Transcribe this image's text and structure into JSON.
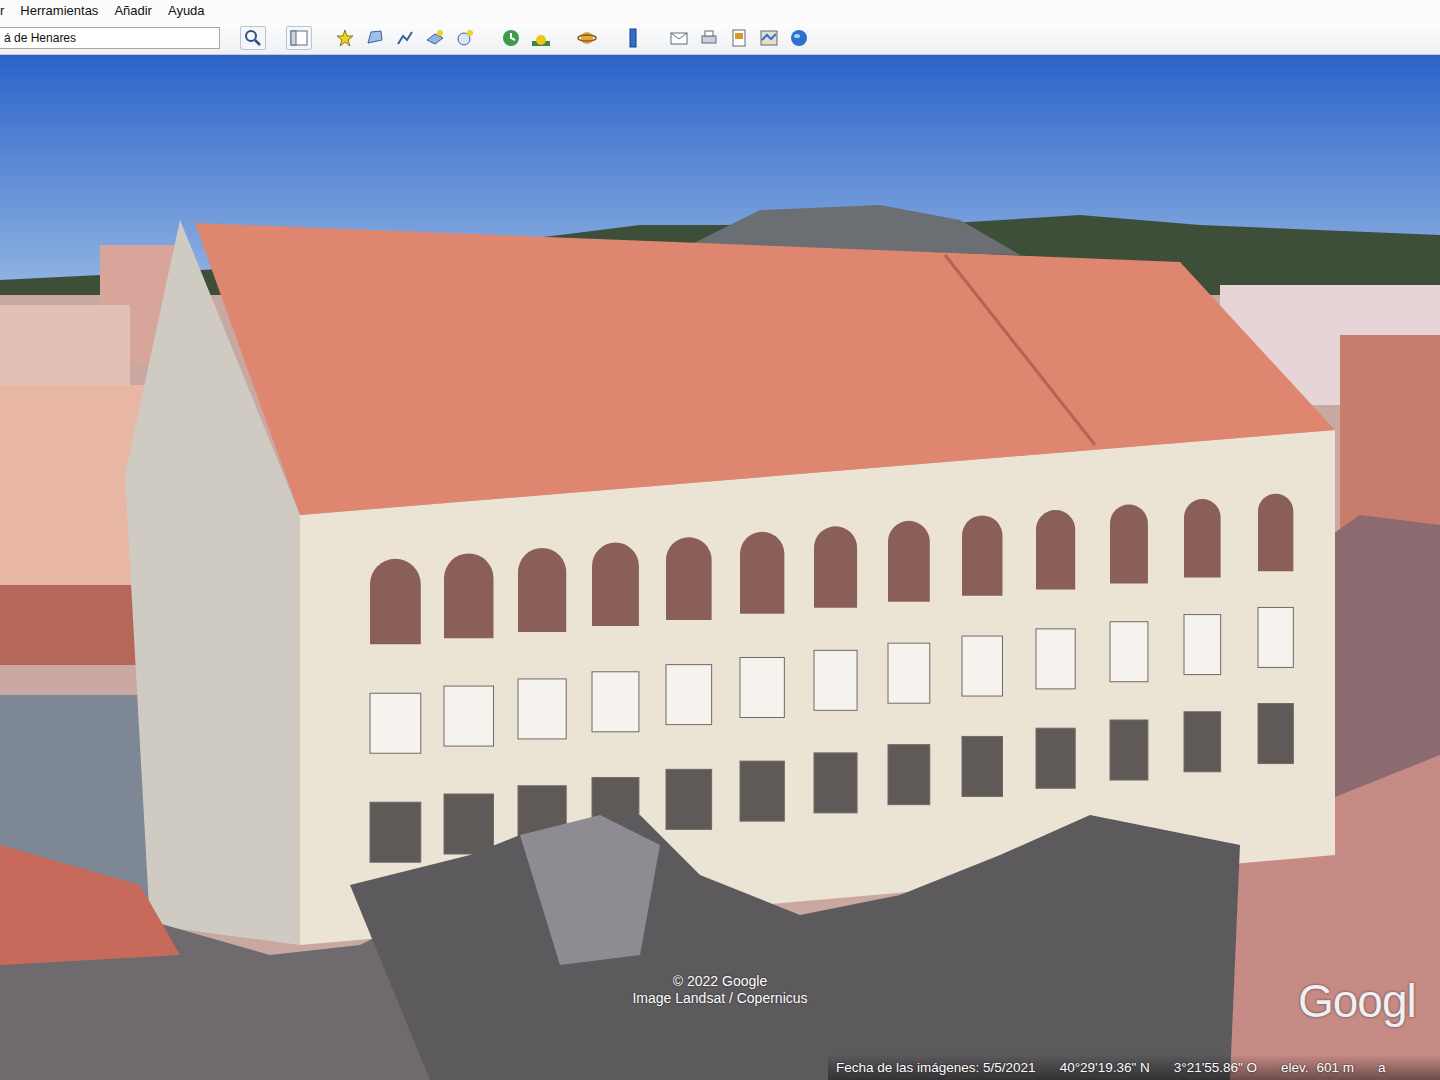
{
  "menu": [
    {
      "label": "r"
    },
    {
      "label": "Herramientas"
    },
    {
      "label": "Añadir"
    },
    {
      "label": "Ayuda"
    }
  ],
  "search": {
    "value": "á de Henares"
  },
  "attribution": [
    "© 2022 Google",
    "Image Landsat / Copernicus"
  ],
  "logo": "Googl",
  "status_bar": {
    "date": "Fecha de las imágenes: 5/5/2021",
    "latitude": "40°29'19.36\" N",
    "longitude": "3°21'55.86\" O",
    "elevation_label": "elev.",
    "elevation": "601 m",
    "extra": "a"
  }
}
